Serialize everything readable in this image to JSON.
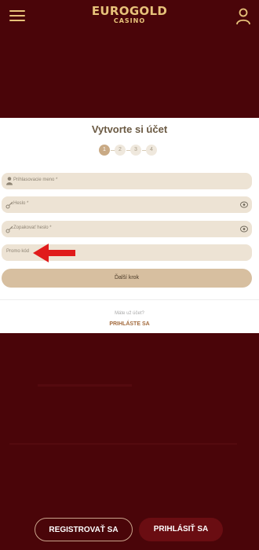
{
  "header": {
    "logo_main": "EUROGOLD",
    "logo_sub": "CASINO",
    "menu_icon": "hamburger-icon",
    "user_icon": "user-icon"
  },
  "form": {
    "title": "Vytvorte si účet",
    "steps": [
      "1",
      "2",
      "3",
      "4"
    ],
    "active_step": 1,
    "username_placeholder": "Prihlasovacie meno *",
    "password_placeholder": "Heslo *",
    "repeat_password_placeholder": "Zopakovať heslo *",
    "promo_placeholder": "Promo kód",
    "next_button": "Ďalší krok",
    "have_account": "Máte už účet?",
    "login_link": "PRIHLÁSTE SA"
  },
  "bottom_bar": {
    "register_button": "REGISTROVAŤ SA",
    "login_button": "PRIHLÁSIŤ SA"
  },
  "colors": {
    "background": "#4a0509",
    "gold": "#e7c27a",
    "field": "#ede3d4",
    "arrow": "#e01b1b"
  }
}
